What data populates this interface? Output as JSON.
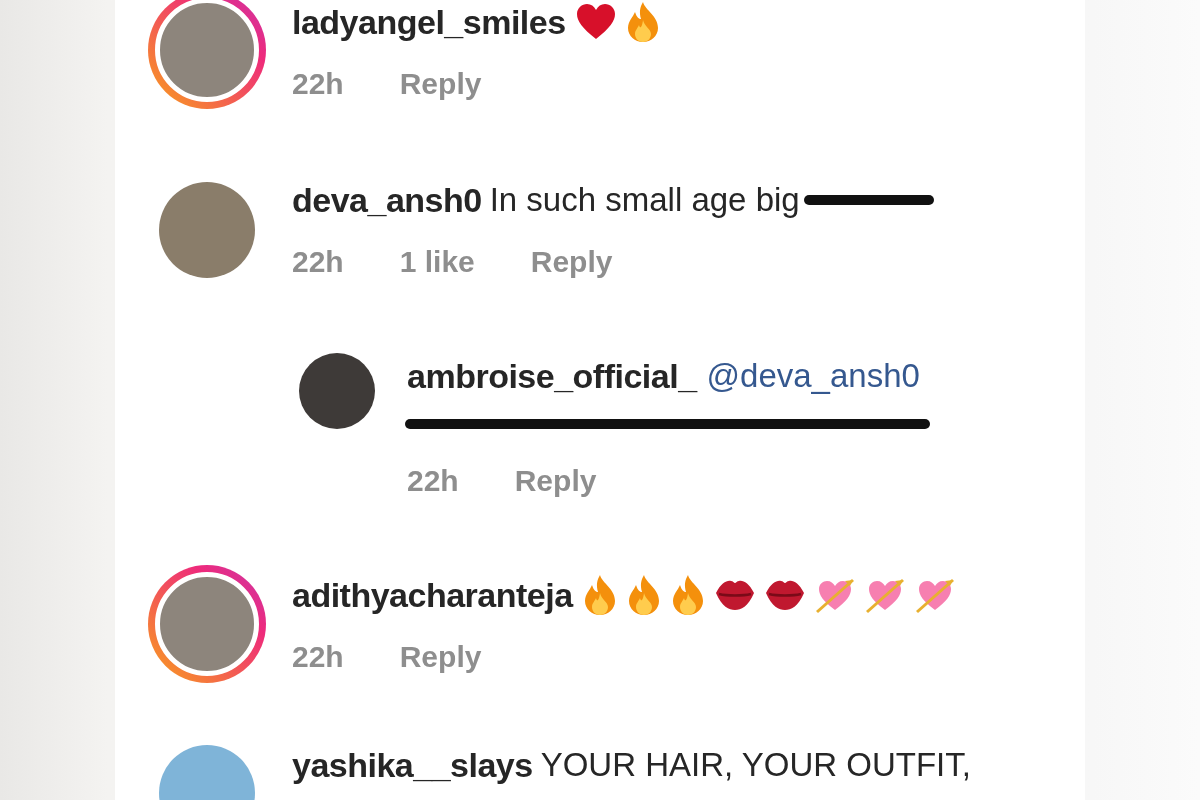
{
  "comments": [
    {
      "username": "ladyangel_smiles",
      "story_ring": true,
      "emoji": [
        {
          "kind": "heart"
        },
        {
          "kind": "fire"
        }
      ],
      "meta": {
        "time": "22h",
        "reply": "Reply"
      }
    },
    {
      "username": "deva_ansh0",
      "story_ring": false,
      "parts": [
        {
          "kind": "text",
          "text": "In such small age big"
        },
        {
          "kind": "redaction_word"
        }
      ],
      "meta": {
        "time": "22h",
        "likes": "1 like",
        "reply": "Reply"
      },
      "replies": [
        {
          "username": "ambroise_official_",
          "story_ring": false,
          "mention": "@deva_ansh0",
          "parts": [
            {
              "kind": "redaction_line"
            }
          ],
          "meta": {
            "time": "22h",
            "reply": "Reply"
          }
        }
      ]
    },
    {
      "username": "adithyacharanteja",
      "story_ring": true,
      "emoji": [
        {
          "kind": "fire"
        },
        {
          "kind": "fire"
        },
        {
          "kind": "fire"
        },
        {
          "kind": "lips"
        },
        {
          "kind": "lips"
        },
        {
          "kind": "heart_arrow"
        },
        {
          "kind": "heart_arrow"
        },
        {
          "kind": "heart_arrow"
        }
      ],
      "meta": {
        "time": "22h",
        "reply": "Reply"
      }
    },
    {
      "username": "yashika__slays",
      "story_ring": false,
      "parts": [
        {
          "kind": "text",
          "text": "YOUR HAIR, YOUR OUTFIT,"
        }
      ]
    }
  ]
}
